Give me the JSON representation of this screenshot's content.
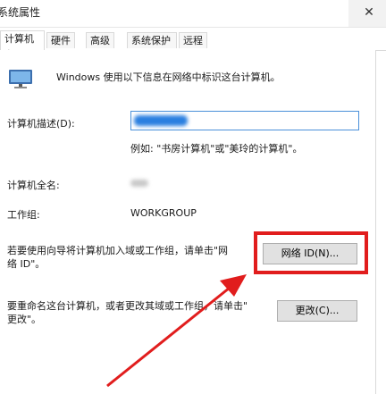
{
  "window": {
    "title": "系统属性",
    "close_glyph": "✕"
  },
  "tabs": [
    {
      "label": "计算机名",
      "active": true
    },
    {
      "label": "硬件"
    },
    {
      "label": "高级"
    },
    {
      "label": "系统保护"
    },
    {
      "label": "远程"
    }
  ],
  "intro_text": "Windows 使用以下信息在网络中标识这台计算机。",
  "description": {
    "label": "计算机描述(D):",
    "example": "例如: \"书房计算机\"或\"美玲的计算机\"。"
  },
  "full_name": {
    "label": "计算机全名:"
  },
  "workgroup": {
    "label": "工作组:",
    "value": "WORKGROUP"
  },
  "network_id": {
    "text_line1": "若要使用向导将计算机加入域或工作组，请单击\"网",
    "text_line2": "络 ID\"。",
    "button_label": "网络 ID(N)..."
  },
  "rename": {
    "text_line1": "要重命名这台计算机，或者更改其域或工作组，请单击\"",
    "text_line2": "更改\"。",
    "button_label": "更改(C)..."
  },
  "annotation_colors": {
    "highlight": "#e11d1d",
    "accent": "#2a7fe0"
  }
}
